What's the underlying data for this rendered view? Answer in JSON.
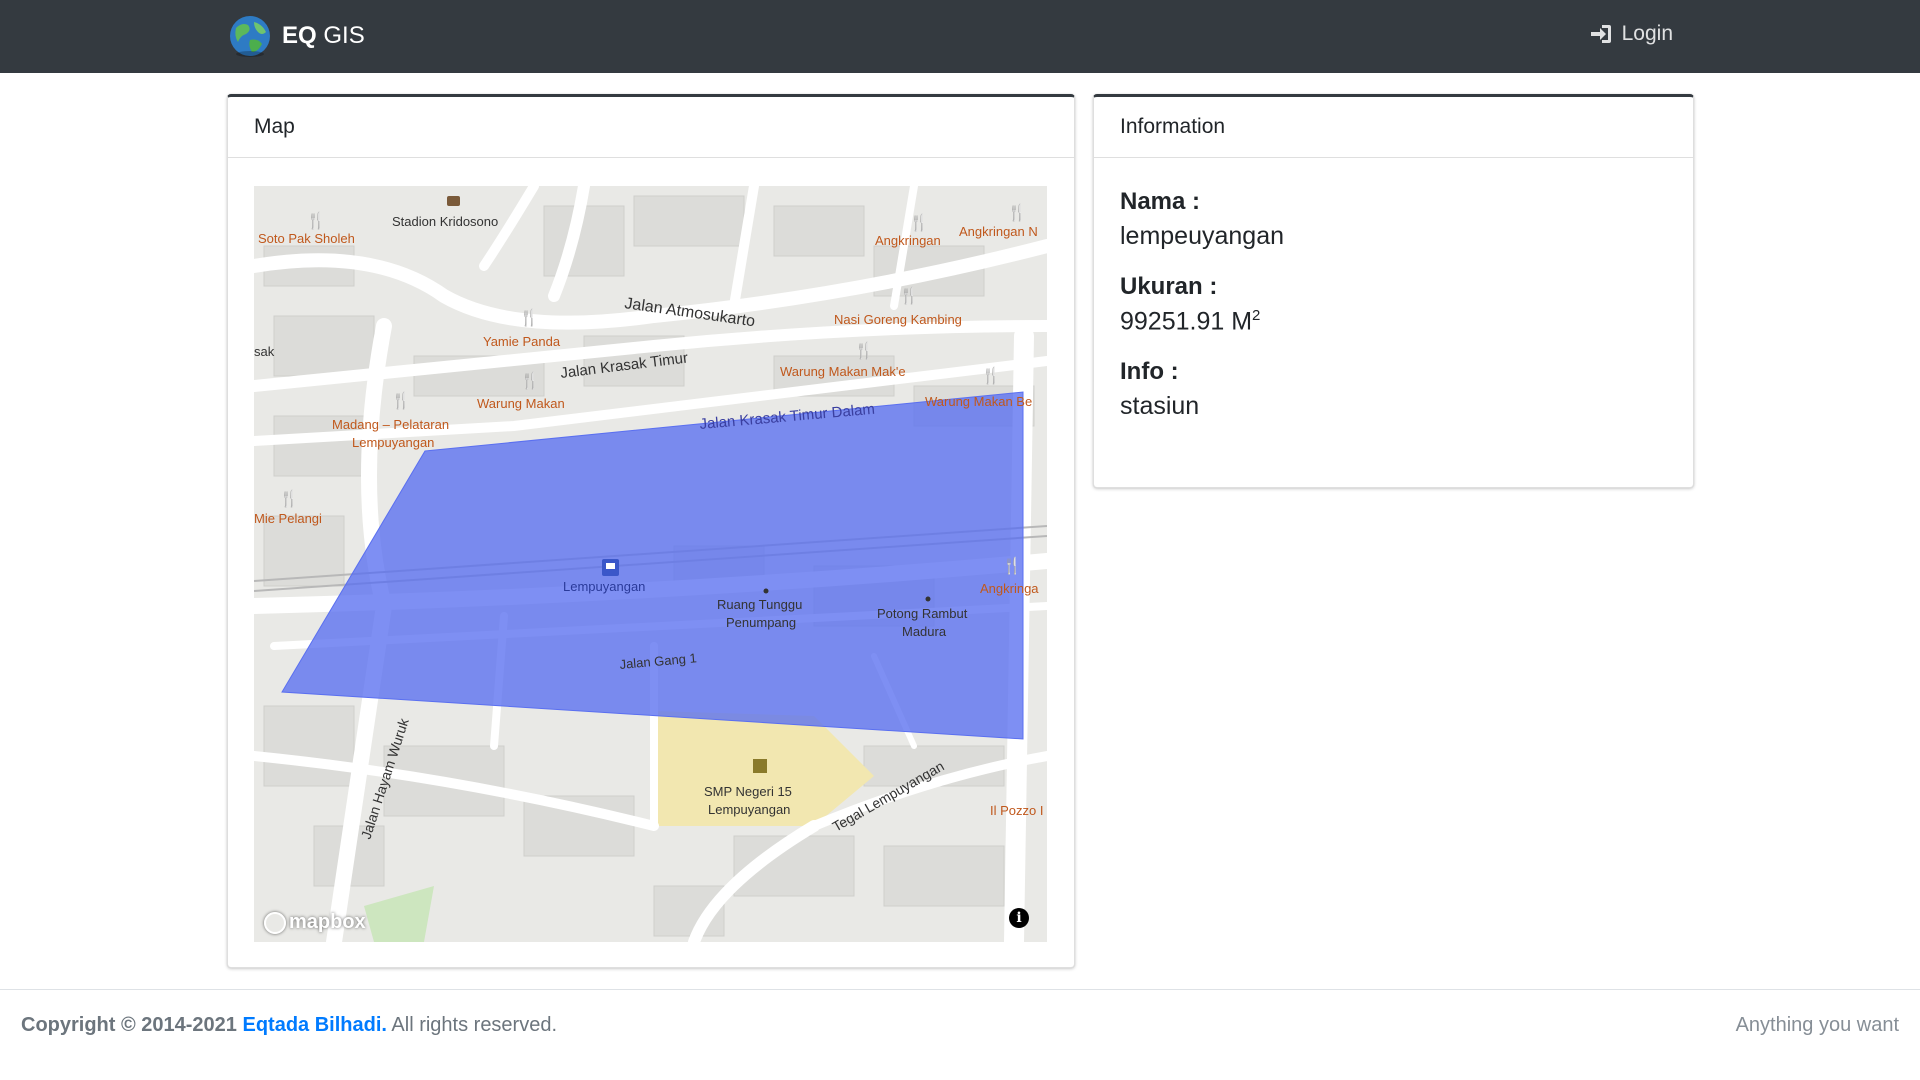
{
  "navbar": {
    "brand_bold": "EQ",
    "brand_rest": " GIS",
    "login_label": "Login"
  },
  "map_card": {
    "title": "Map",
    "map_labels": {
      "stadion": "Stadion Kridosono",
      "soto": "Soto Pak Sholeh",
      "angkringan_top": "Angkringan",
      "angkringan_right": "Angkringan N",
      "atmosukarto": "Jalan Atmosukarto",
      "nasi_goreng": "Nasi Goreng Kambing",
      "yamie": "Yamie Panda",
      "sak": "sak",
      "krasak_timur": "Jalan Krasak Timur",
      "warung_make": "Warung Makan Mak'e",
      "warung_makan": "Warung Makan",
      "warung_makan_be": "Warung Makan Be",
      "madang1": "Madang – Pelataran",
      "madang2": "Lempuyangan",
      "krasak_dalam": "Jalan Krasak Timur Dalam",
      "mie_pelangi": "Mie Pelangi",
      "lempuyangan": "Lempuyangan",
      "ruang1": "Ruang Tunggu",
      "ruang2": "Penumpang",
      "potong1": "Potong Rambut",
      "potong2": "Madura",
      "angkringan_mid": "Angkringa",
      "gang1": "Jalan Gang 1",
      "hayam_wuruk": "Jalan Hayam Wuruk",
      "smp1": "SMP Negeri 15",
      "smp2": "Lempuyangan",
      "tegal": "Tegal Lempuyangan",
      "pozzo": "Il Pozzo I"
    },
    "attribution": "mapbox",
    "info_symbol": "i",
    "polygon_color": "#5a6ff0"
  },
  "info_card": {
    "title": "Information",
    "nama_label": "Nama :",
    "nama_value": "lempeuyangan",
    "ukuran_label": "Ukuran :",
    "ukuran_value": "99251.91 M",
    "ukuran_unit_sup": "2",
    "info_label": "Info :",
    "info_value": "stasiun"
  },
  "footer": {
    "copyright_prefix": "Copyright © 2014-2021 ",
    "author": "Eqtada Bilhadi.",
    "rights": " All rights reserved.",
    "right_text": "Anything you want"
  }
}
